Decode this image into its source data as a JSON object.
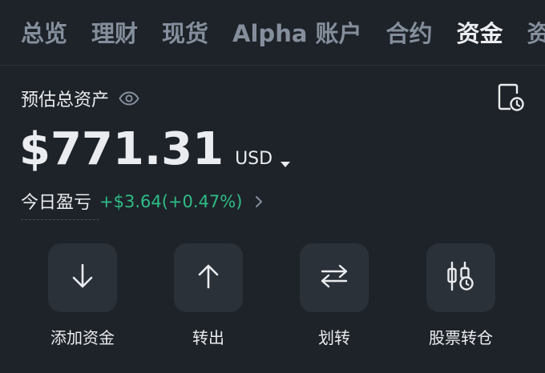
{
  "tabs": [
    {
      "label": "总览",
      "active": false
    },
    {
      "label": "理财",
      "active": false
    },
    {
      "label": "现货",
      "active": false
    },
    {
      "label": "Alpha 账户",
      "active": false
    },
    {
      "label": "合约",
      "active": false
    },
    {
      "label": "资金",
      "active": true
    },
    {
      "label": "资",
      "active": false
    }
  ],
  "header": {
    "estimated_label": "预估总资产",
    "eye_icon": "eye-icon",
    "history_icon": "history-icon"
  },
  "balance": {
    "amount": "$771.31",
    "currency": "USD"
  },
  "pnl": {
    "label": "今日盈亏",
    "value": "+$3.64(+0.47%)"
  },
  "actions": [
    {
      "label": "添加资金",
      "icon": "arrow-down-icon"
    },
    {
      "label": "转出",
      "icon": "arrow-up-icon"
    },
    {
      "label": "划转",
      "icon": "transfer-icon"
    },
    {
      "label": "股票转仓",
      "icon": "stock-transfer-icon"
    }
  ],
  "colors": {
    "background": "#1e2329",
    "tile": "#2b3139",
    "text_primary": "#eaecef",
    "text_secondary": "#848e9c",
    "positive": "#2ebd85"
  }
}
